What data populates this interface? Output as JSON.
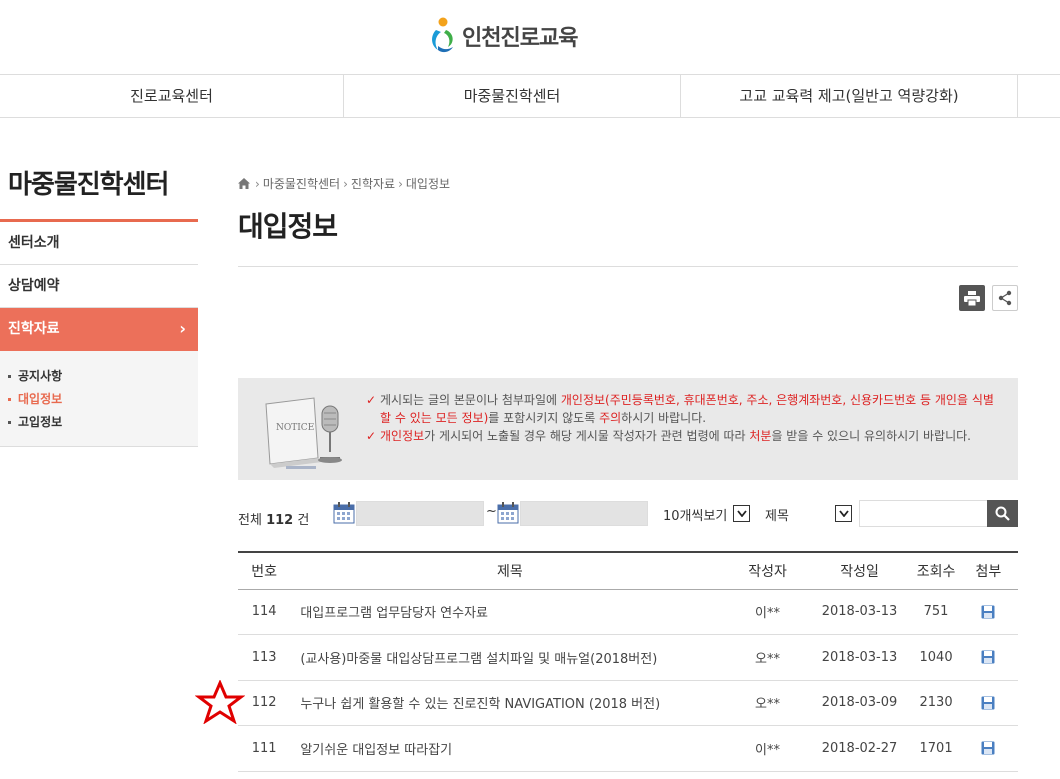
{
  "header": {
    "logo_text": "인천진로교육"
  },
  "gnb": {
    "items": [
      "진로교육센터",
      "마중물진학센터",
      "고교 교육력 제고(일반고 역량강화)"
    ]
  },
  "lnb": {
    "title": "마중물진학센터",
    "items": [
      "센터소개",
      "상담예약",
      "진학자료"
    ],
    "sub_items": [
      "공지사항",
      "대입정보",
      "고입정보"
    ]
  },
  "breadcrumb": [
    "마중물진학센터",
    "진학자료",
    "대입정보"
  ],
  "page_title": "대입정보",
  "notice": {
    "line1_a": "게시되는 글의 본문이나 첨부파일에 ",
    "line1_b": "개인정보(주민등록번호, 휴대폰번호, 주소, 은행계좌번호, 신용카드번호 등 개인을 식별할 수 있는 모든 정보)",
    "line1_c": "를 포함시키지 않도록 ",
    "line1_d": "주의",
    "line1_e": "하시기 바랍니다.",
    "line2_a": "개인정보",
    "line2_b": "가 게시되어 노출될 경우 해당 게시물 작성자가 관련 법령에 따라 ",
    "line2_c": "처분",
    "line2_d": "을 받을 수 있으니 유의하시기 바랍니다.",
    "illustration_label": "NOTICE"
  },
  "search": {
    "total_prefix": "전체",
    "total_count": "112",
    "total_suffix": "건",
    "tilde": "~",
    "per_page": "10개씩보기",
    "field": "제목"
  },
  "table": {
    "headers": [
      "번호",
      "제목",
      "작성자",
      "작성일",
      "조회수",
      "첨부"
    ],
    "rows": [
      {
        "num": "114",
        "subject": "대입프로그램 업무담당자 연수자료",
        "author": "이**",
        "date": "2018-03-13",
        "views": "751"
      },
      {
        "num": "113",
        "subject": "(교사용)마중물 대입상담프로그램 설치파일 및 매뉴얼(2018버전)",
        "author": "오**",
        "date": "2018-03-13",
        "views": "1040"
      },
      {
        "num": "112",
        "subject": "누구나 쉽게 활용할 수 있는 진로진학 NAVIGATION (2018 버전)",
        "author": "오**",
        "date": "2018-03-09",
        "views": "2130"
      },
      {
        "num": "111",
        "subject": "알기쉬운 대입정보 따라잡기",
        "author": "이**",
        "date": "2018-02-27",
        "views": "1701"
      }
    ]
  },
  "colors": {
    "accent": "#ec705a",
    "notice_red": "#dd2222",
    "file_icon": "#4a7fc1",
    "star": "#e00000"
  },
  "icons": [
    "logo-mark-icon",
    "home-icon",
    "printer-icon",
    "share-icon",
    "check-icon",
    "calendar-icon",
    "dropdown-arrow-icon",
    "search-icon",
    "save-file-icon",
    "star-annotation-icon",
    "chevron-right-icon"
  ]
}
